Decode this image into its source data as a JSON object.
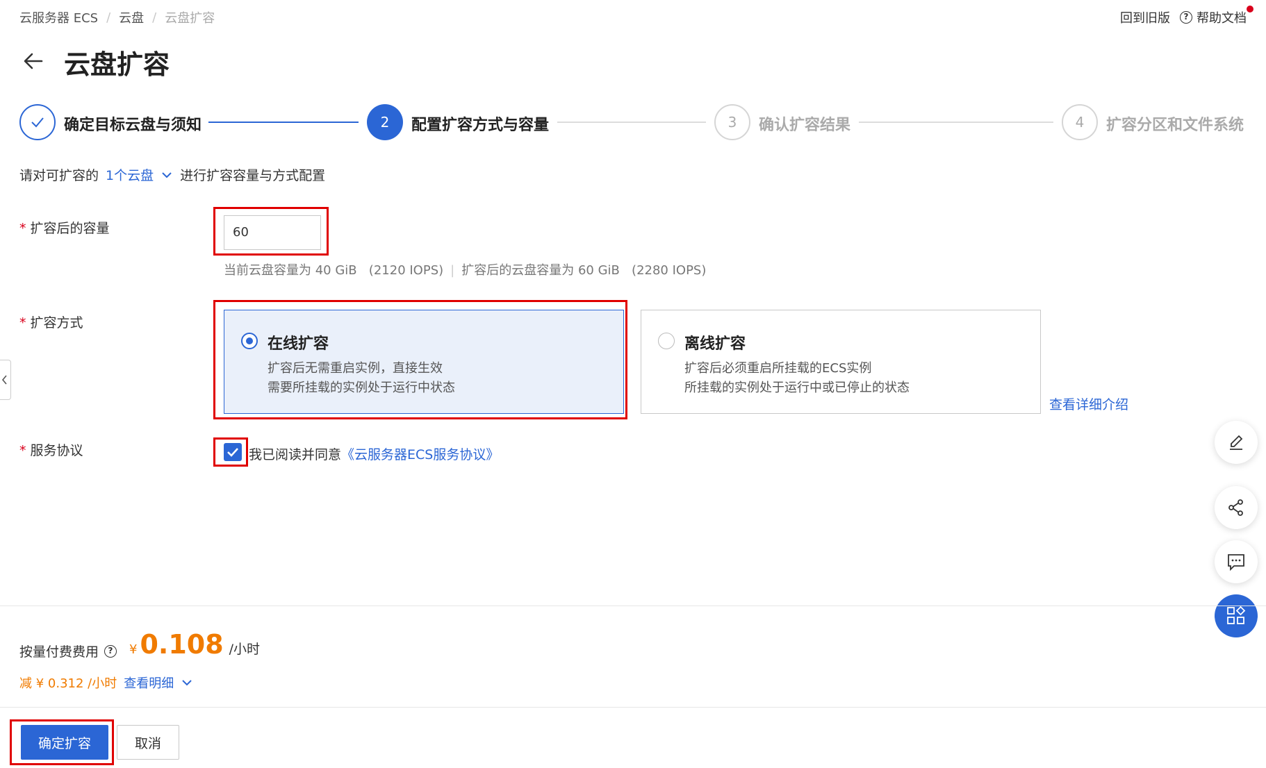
{
  "breadcrumb": {
    "item1": "云服务器 ECS",
    "item2": "云盘",
    "current": "云盘扩容",
    "sep": "/"
  },
  "topbar": {
    "old_version": "回到旧版",
    "help_docs": "帮助文档",
    "help_icon": "?"
  },
  "page": {
    "title": "云盘扩容"
  },
  "steps": [
    {
      "number": "",
      "label": "确定目标云盘与须知",
      "state": "done"
    },
    {
      "number": "2",
      "label": "配置扩容方式与容量",
      "state": "active"
    },
    {
      "number": "3",
      "label": "确认扩容结果",
      "state": "todo"
    },
    {
      "number": "4",
      "label": "扩容分区和文件系统",
      "state": "todo"
    }
  ],
  "intro": {
    "prefix": "请对可扩容的",
    "link": "1个云盘",
    "suffix": "进行扩容容量与方式配置"
  },
  "capacity": {
    "label": "扩容后的容量",
    "required_mark": "*",
    "value": "60",
    "tip_current": "当前云盘容量为 40 GiB   (2120 IOPS)",
    "tip_sep": "|",
    "tip_after": "扩容后的云盘容量为 60 GiB   (2280 IOPS)"
  },
  "method": {
    "label": "扩容方式",
    "required_mark": "*",
    "online": {
      "title": "在线扩容",
      "line1": "扩容后无需重启实例，直接生效",
      "line2": "需要所挂载的实例处于运行中状态",
      "selected": true
    },
    "offline": {
      "title": "离线扩容",
      "line1": "扩容后必须重启所挂载的ECS实例",
      "line2": "所挂载的实例处于运行中或已停止的状态",
      "selected": false
    },
    "detail_link": "查看详细介绍"
  },
  "agreement": {
    "label": "服务协议",
    "required_mark": "*",
    "checked": true,
    "text": "我已阅读并同意",
    "link": "《云服务器ECS服务协议》"
  },
  "fee": {
    "label": "按量付费费用",
    "currency": "¥",
    "price": "0.108",
    "unit": "/小时",
    "discount": "减 ¥ 0.312 /小时",
    "detail_link": "查看明细"
  },
  "actions": {
    "confirm": "确定扩容",
    "cancel": "取消"
  },
  "colors": {
    "primary": "#2b66d5",
    "price": "#f07b00",
    "required": "#d9001b",
    "highlight": "#e00000"
  },
  "icons": [
    "arrow-left-icon",
    "check-icon",
    "chevron-down-icon",
    "edit-icon",
    "share-icon",
    "feedback-icon",
    "apps-icon",
    "question-circle-icon"
  ]
}
